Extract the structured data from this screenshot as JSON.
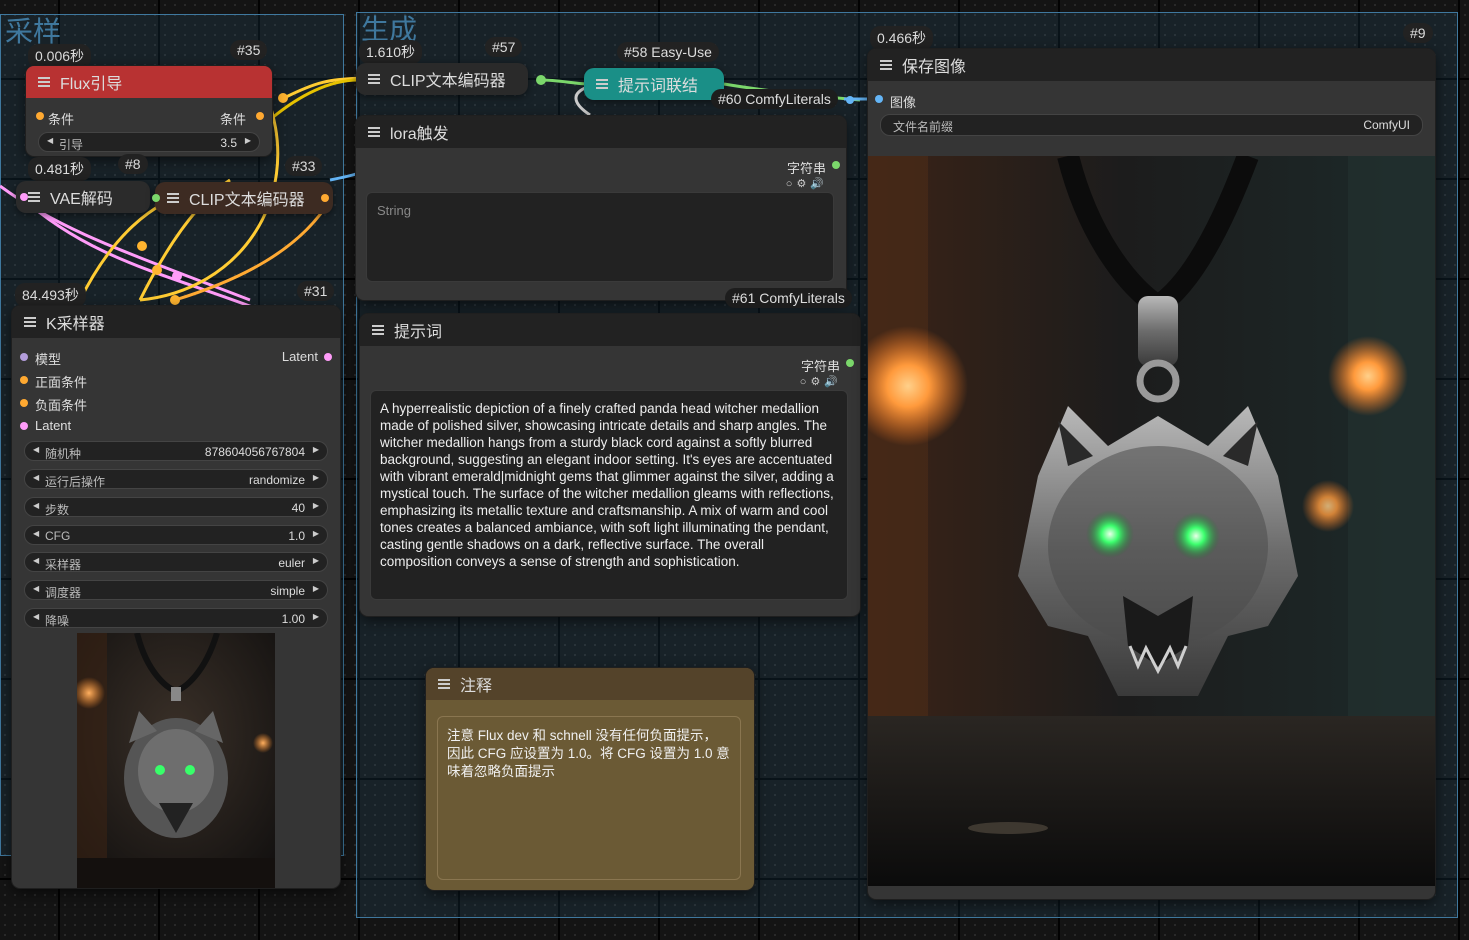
{
  "groups": {
    "sampling_title": "采样",
    "generate_title": "生成"
  },
  "nodes": {
    "flux_guidance": {
      "id": "#35",
      "time": "0.006秒",
      "title": "Flux引导",
      "input_label": "条件",
      "output_label": "条件",
      "widget_name": "引导",
      "widget_value": "3.5"
    },
    "vae_decode": {
      "id": "#8",
      "time": "0.481秒",
      "title": "VAE解码"
    },
    "clip_encoder_33": {
      "id": "#33",
      "title": "CLIP文本编码器"
    },
    "ksampler": {
      "id": "#31",
      "time": "84.493秒",
      "title": "K采样器",
      "inputs": [
        "模型",
        "正面条件",
        "负面条件",
        "Latent"
      ],
      "output": "Latent",
      "widgets": [
        {
          "name": "随机种",
          "value": "878604056767804"
        },
        {
          "name": "运行后操作",
          "value": "randomize"
        },
        {
          "name": "步数",
          "value": "40"
        },
        {
          "name": "CFG",
          "value": "1.0"
        },
        {
          "name": "采样器",
          "value": "euler"
        },
        {
          "name": "调度器",
          "value": "simple"
        },
        {
          "name": "降噪",
          "value": "1.00"
        }
      ]
    },
    "clip_encoder_57": {
      "id": "#57",
      "time": "1.610秒",
      "title": "CLIP文本编码器"
    },
    "prompt_concat": {
      "id": "#58 Easy-Use",
      "title": "提示词联结"
    },
    "comfy60": {
      "title": "#60 ComfyLiterals"
    },
    "lora_trigger": {
      "title": "lora触发",
      "output_label": "字符串",
      "placeholder": "String"
    },
    "comfy61": {
      "title": "#61 ComfyLiterals"
    },
    "prompt": {
      "title": "提示词",
      "output_label": "字符串",
      "text": "A hyperrealistic depiction of a finely crafted panda head witcher medallion made of polished silver, showcasing intricate details and sharp angles. The witcher medallion hangs from a sturdy black cord against a softly blurred background, suggesting an elegant indoor setting. It's eyes are accentuated with vibrant emerald|midnight gems that glimmer against the silver, adding a mystical touch. The surface of the witcher medallion gleams with reflections, emphasizing its metallic texture and craftsmanship. A mix of warm and cool tones creates a balanced ambiance, with soft light illuminating the pendant, casting gentle shadows on a dark, reflective surface. The overall composition conveys a sense of strength and sophistication."
    },
    "note": {
      "title": "注释",
      "text": "注意 Flux dev 和 schnell 没有任何负面提示，因此 CFG 应设置为 1.0。将 CFG 设置为 1.0 意味着忽略负面提示"
    },
    "save_image": {
      "id": "#9",
      "time": "0.466秒",
      "title": "保存图像",
      "input_label": "图像",
      "prefix_name": "文件名前缀",
      "prefix_value": "ComfyUI"
    }
  },
  "colors": {
    "flux_header": "#b83232",
    "teal": "#1a8f87",
    "brown_node": "#3d2b22",
    "note_body": "#6b5a35",
    "note_head": "#54432a",
    "conditioning": "#ffa931",
    "latent": "#ff9cf9",
    "string": "#7bd76b",
    "image": "#64b5f6"
  }
}
